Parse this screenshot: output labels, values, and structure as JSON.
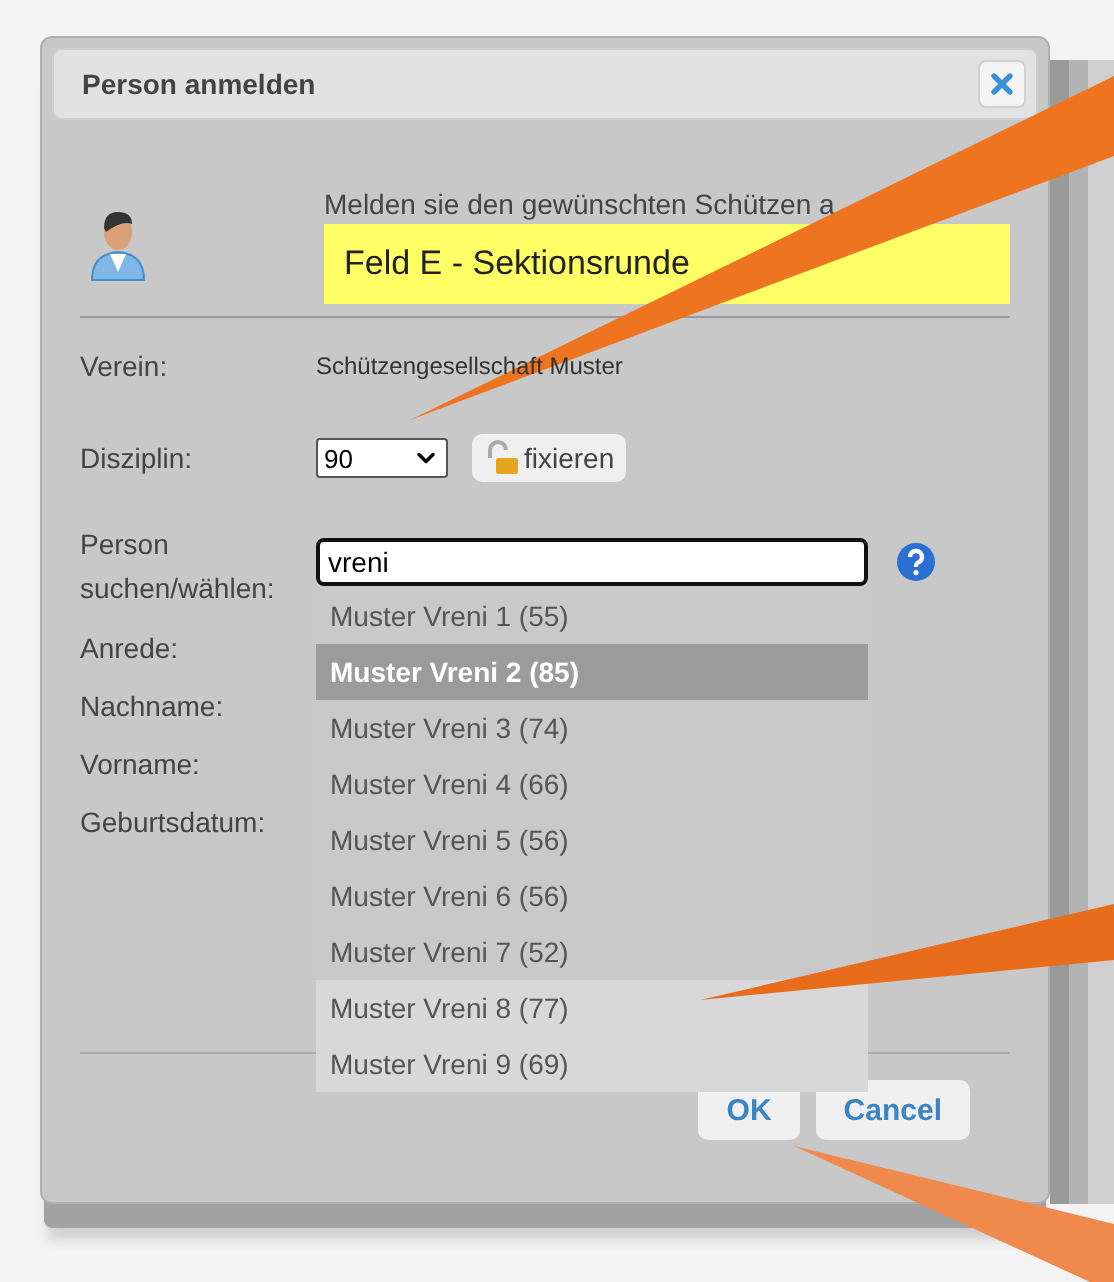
{
  "dialog": {
    "title": "Person anmelden"
  },
  "intro_text": "Melden sie den gewünschten Schützen a",
  "event_banner": "Feld E - Sektionsrunde",
  "verein": {
    "label": "Verein:",
    "value": "Schützengesellschaft Muster"
  },
  "disziplin": {
    "label": "Disziplin:",
    "value": "90",
    "fix_button": "fixieren"
  },
  "person_search": {
    "label": "Person suchen/wählen:",
    "value": "vreni"
  },
  "suggestions": [
    {
      "label": "Muster Vreni 1 (55)",
      "selected": false
    },
    {
      "label": "Muster Vreni 2 (85)",
      "selected": true
    },
    {
      "label": "Muster Vreni 3 (74)",
      "selected": false
    },
    {
      "label": "Muster Vreni 4 (66)",
      "selected": false
    },
    {
      "label": "Muster Vreni 5 (56)",
      "selected": false
    },
    {
      "label": "Muster Vreni 6 (56)",
      "selected": false
    },
    {
      "label": "Muster Vreni 7 (52)",
      "selected": false
    },
    {
      "label": "Muster Vreni 8 (77)",
      "selected": false
    },
    {
      "label": "Muster Vreni 9 (69)",
      "selected": false
    }
  ],
  "person_fields": [
    "Anrede:",
    "Nachname:",
    "Vorname:",
    "Geburtsdatum:"
  ],
  "buttons": [
    "OK",
    "Cancel"
  ]
}
